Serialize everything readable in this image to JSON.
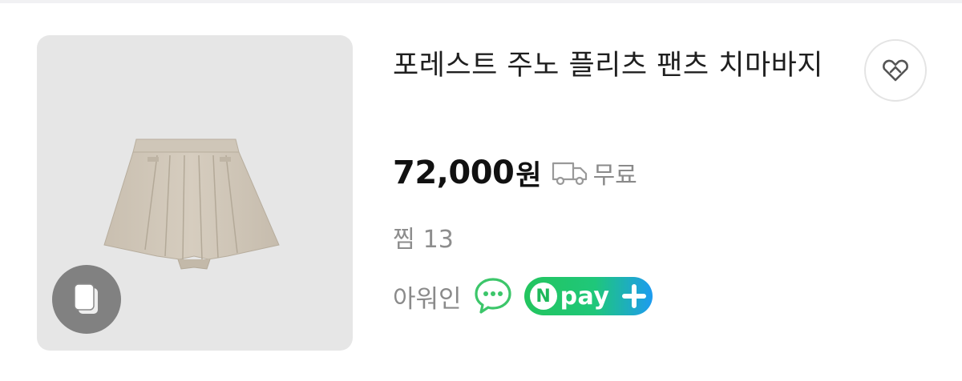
{
  "product": {
    "title": "포레스트 주노 플리츠 팬츠 치마바지",
    "price": "72,000",
    "price_unit": "원",
    "shipping_label": "무료",
    "likes_label": "찜",
    "likes_count": "13",
    "seller_name": "아워인",
    "npay_badge": {
      "n_letter": "N",
      "text": "pay"
    },
    "thumbnail_icon": "multi-image-icon",
    "shipping_icon": "delivery-truck-icon",
    "chat_icon": "talk-bubble-icon",
    "favorite_icon": "heart-tag-icon"
  },
  "colors": {
    "npay_green": "#1fc77a",
    "npay_blue": "#1d9bf0",
    "talk_green": "#3cc66a"
  }
}
